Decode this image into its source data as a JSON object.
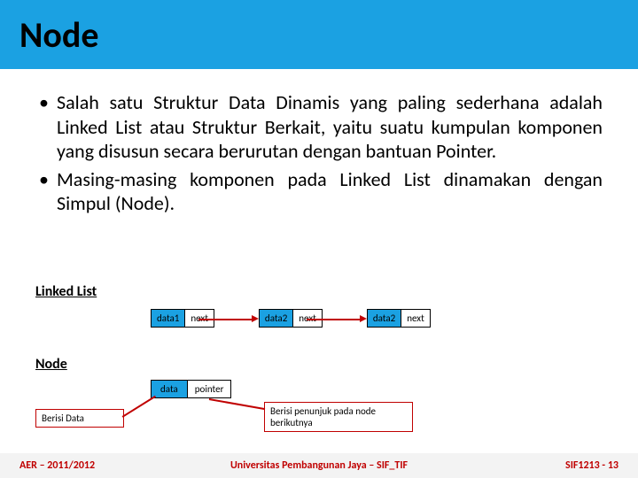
{
  "title": "Node",
  "bullets": [
    "Salah  satu  Struktur  Data  Dinamis  yang  paling sederhana  adalah  Linked  List  atau  Struktur  Berkait, yaitu suatu  kumpulan  komponen yang  disusun  secara  berurutan  dengan  bantuan Pointer.",
    "Masing-masing komponen pada Linked List  dinamakan dengan  Simpul  (Node)."
  ],
  "linkedlist": {
    "label": "Linked List",
    "nodes": [
      {
        "data": "data1",
        "ptr": "next"
      },
      {
        "data": "data2",
        "ptr": "next"
      },
      {
        "data": "data2",
        "ptr": "next"
      }
    ]
  },
  "node": {
    "label": "Node",
    "data": "data",
    "ptr": "pointer"
  },
  "callouts": {
    "left": "Berisi Data",
    "right": "Berisi penunjuk pada node berikutnya"
  },
  "footer": {
    "left": "AER – 2011/2012",
    "center": "Universitas Pembangunan Jaya – SIF_TIF",
    "right": "SIF1213 - 13"
  }
}
